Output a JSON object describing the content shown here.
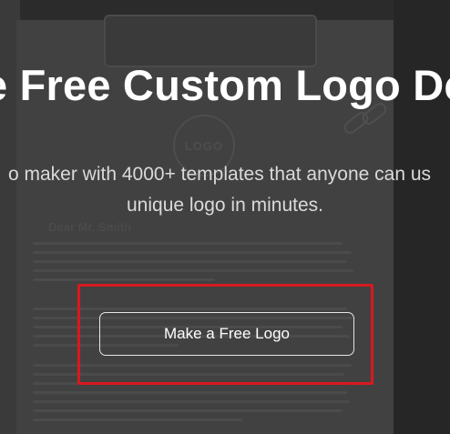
{
  "hero": {
    "headline": "e Free Custom Logo De",
    "subline_1": "o maker with 4000+ templates that anyone can us",
    "subline_2": "unique logo in minutes.",
    "cta_label": "Make a Free Logo",
    "highlight_color": "#d8191f"
  },
  "background": {
    "stamp_text": "LOGO",
    "letter_greeting": "Dear Mr. Smith"
  }
}
